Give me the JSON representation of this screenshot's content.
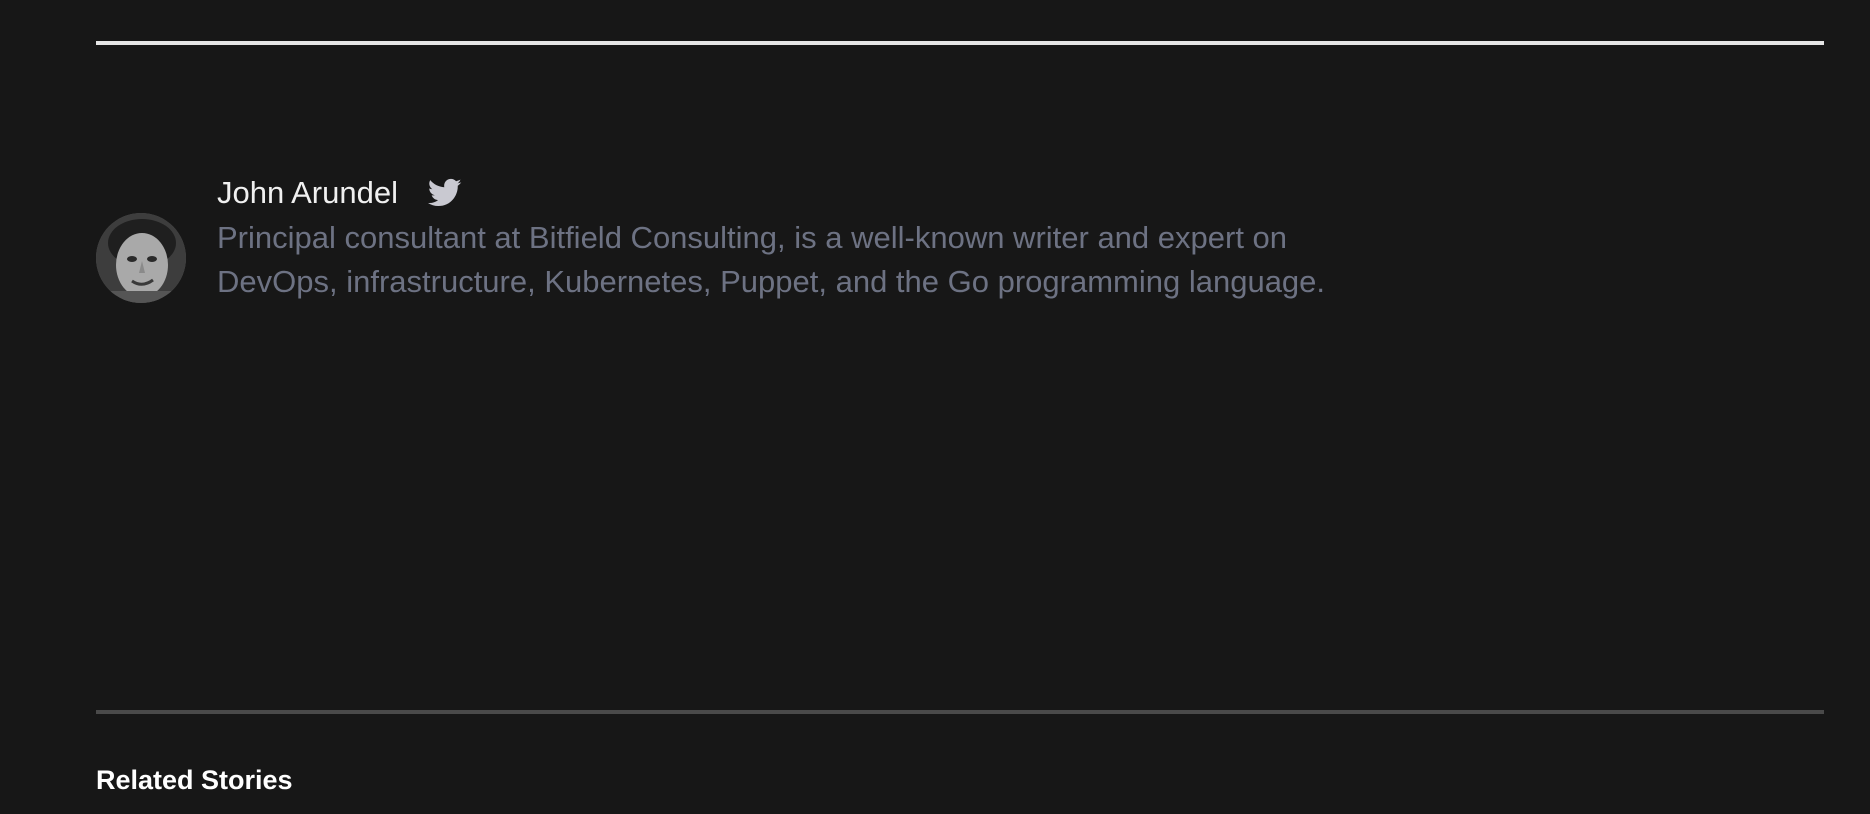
{
  "author": {
    "name": "John Arundel",
    "bio": "Principal consultant at Bitfield Consulting, is a well-known writer and expert on DevOps, infrastructure, Kubernetes, Puppet, and the Go programming language.",
    "social_icon": "twitter-icon"
  },
  "related": {
    "heading": "Related Stories"
  },
  "colors": {
    "background": "#171717",
    "name_text": "#f0f0f0",
    "bio_text": "#6d7283",
    "top_divider": "#e6e6e6",
    "bottom_divider": "#4a4a4a",
    "icon": "#c9c9d1"
  }
}
